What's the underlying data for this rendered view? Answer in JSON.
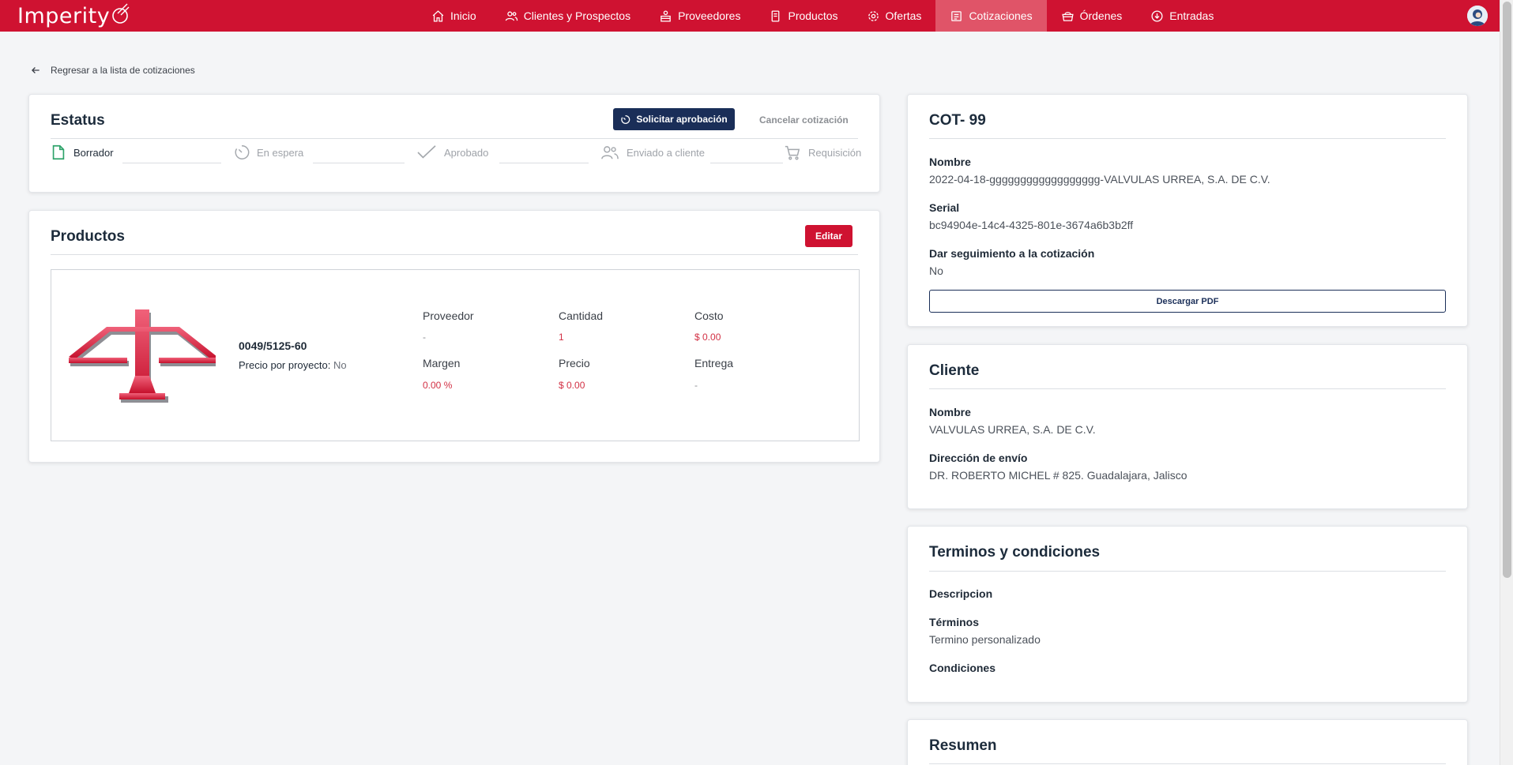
{
  "app": {
    "logo_text": "Imperity"
  },
  "nav": {
    "items": [
      {
        "label": "Inicio",
        "icon": "home-icon"
      },
      {
        "label": "Clientes y Prospectos",
        "icon": "users-icon"
      },
      {
        "label": "Proveedores",
        "icon": "supplier-icon"
      },
      {
        "label": "Productos",
        "icon": "product-icon"
      },
      {
        "label": "Ofertas",
        "icon": "gear-icon"
      },
      {
        "label": "Cotizaciones",
        "icon": "document-icon",
        "active": true
      },
      {
        "label": "Órdenes",
        "icon": "basket-icon"
      },
      {
        "label": "Entradas",
        "icon": "download-icon"
      }
    ]
  },
  "back_link": "Regresar a la lista de cotizaciones",
  "status": {
    "title": "Estatus",
    "request_button": "Solicitar aprobación",
    "cancel_button": "Cancelar cotización",
    "steps": [
      {
        "label": "Borrador",
        "icon": "draft-icon"
      },
      {
        "label": "En espera",
        "icon": "timer-icon"
      },
      {
        "label": "Aprobado",
        "icon": "check-icon"
      },
      {
        "label": "Enviado a cliente",
        "icon": "users-icon"
      },
      {
        "label": "Requisición",
        "icon": "cart-icon"
      }
    ]
  },
  "products": {
    "title": "Productos",
    "edit_button": "Editar",
    "item": {
      "code": "0049/5125-60",
      "project_price_label": "Precio por proyecto:",
      "project_price_value": "No",
      "fields": {
        "proveedor_label": "Proveedor",
        "proveedor_value": "-",
        "cantidad_label": "Cantidad",
        "cantidad_value": "1",
        "costo_label": "Costo",
        "costo_value": "$ 0.00",
        "margen_label": "Margen",
        "margen_value": "0.00 %",
        "precio_label": "Precio",
        "precio_value": "$ 0.00",
        "entrega_label": "Entrega",
        "entrega_value": "-"
      }
    }
  },
  "quote": {
    "title": "COT- 99",
    "name_label": "Nombre",
    "name_value": "2022-04-18-gggggggggggggggggg-VALVULAS URREA, S.A. DE C.V.",
    "serial_label": "Serial",
    "serial_value": "bc94904e-14c4-4325-801e-3674a6b3b2ff",
    "followup_label": "Dar seguimiento a la cotización",
    "followup_value": "No",
    "pdf_button": "Descargar PDF"
  },
  "client": {
    "title": "Cliente",
    "name_label": "Nombre",
    "name_value": "VALVULAS URREA, S.A. DE C.V.",
    "address_label": "Dirección de envío",
    "address_value": "DR. ROBERTO MICHEL # 825. Guadalajara, Jalisco"
  },
  "terms": {
    "title": "Terminos y condiciones",
    "description_label": "Descripcion",
    "terms_label": "Términos",
    "terms_value": "Termino personalizado",
    "conditions_label": "Condiciones"
  },
  "summary": {
    "title": "Resumen"
  },
  "colors": {
    "brand": "#cf1231",
    "primary": "#1a2e58",
    "active_tab": "#e05468"
  }
}
